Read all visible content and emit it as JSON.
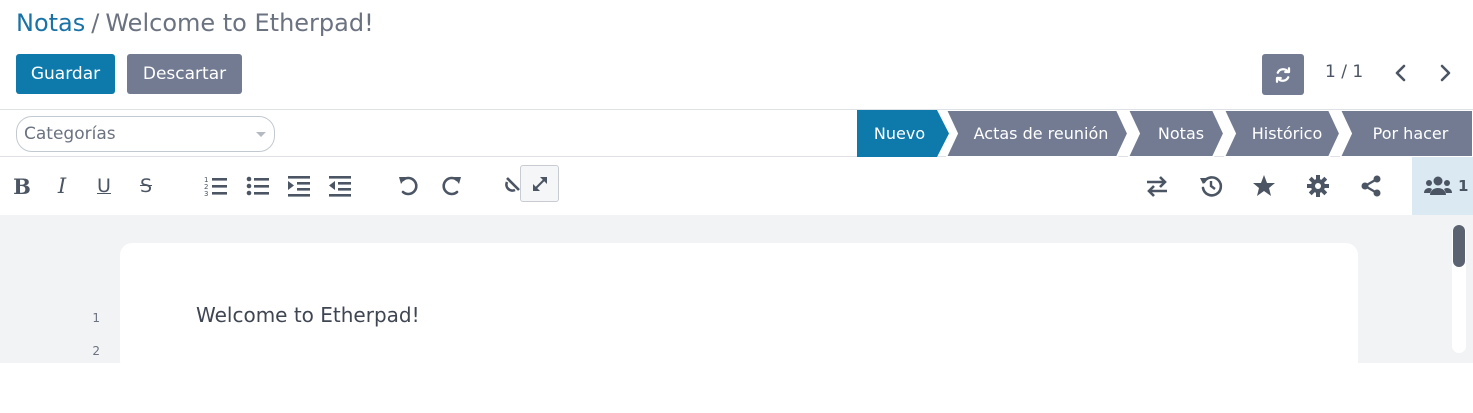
{
  "breadcrumb": {
    "parent": "Notas",
    "separator": "/",
    "current": "Welcome to Etherpad!"
  },
  "actions": {
    "save": "Guardar",
    "discard": "Descartar"
  },
  "pager": {
    "value": "1 / 1"
  },
  "categories": {
    "placeholder": "Categorías"
  },
  "stages": [
    {
      "label": "Nuevo",
      "active": true
    },
    {
      "label": "Actas de reunión",
      "active": false
    },
    {
      "label": "Notas",
      "active": false
    },
    {
      "label": "Histórico",
      "active": false
    },
    {
      "label": "Por hacer",
      "active": false
    }
  ],
  "toolbar": {
    "bold": "B",
    "italic": "I",
    "underline": "U",
    "strike": "S",
    "icons": [
      "ordered-list-icon",
      "unordered-list-icon",
      "indent-icon",
      "outdent-icon",
      "undo-icon",
      "redo-icon",
      "clear-authorship-icon",
      "expand-icon",
      "import-export-icon",
      "timeslider-icon",
      "star-icon",
      "settings-icon",
      "share-icon",
      "users-icon"
    ],
    "user_count": "1"
  },
  "editor": {
    "lines": [
      {
        "number": "1",
        "text": "Welcome to Etherpad!"
      },
      {
        "number": "2",
        "text": ""
      }
    ]
  },
  "colors": {
    "primary": "#0e7aac",
    "secondary": "#727b91",
    "link": "#1a73a7",
    "editor_bg": "#f2f3f5",
    "users_bg": "#dbeaf2"
  }
}
